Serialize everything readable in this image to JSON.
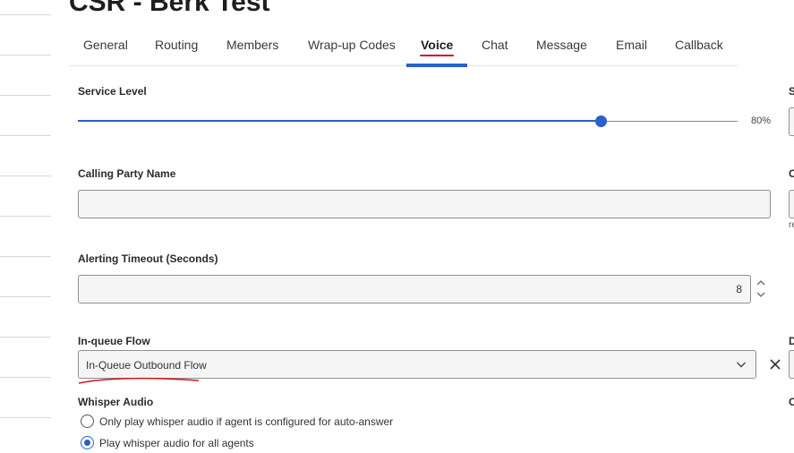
{
  "page": {
    "title": "CSR - Berk Test"
  },
  "tabs": [
    {
      "label": "General",
      "active": false
    },
    {
      "label": "Routing",
      "active": false
    },
    {
      "label": "Members",
      "active": false
    },
    {
      "label": "Wrap-up Codes",
      "active": false
    },
    {
      "label": "Voice",
      "active": true
    },
    {
      "label": "Chat",
      "active": false
    },
    {
      "label": "Message",
      "active": false
    },
    {
      "label": "Email",
      "active": false
    },
    {
      "label": "Callback",
      "active": false
    }
  ],
  "service_level": {
    "label": "Service Level",
    "value": 0.8,
    "display": "80%"
  },
  "calling_party_name": {
    "label": "Calling Party Name",
    "value": ""
  },
  "alerting_timeout": {
    "label": "Alerting Timeout (Seconds)",
    "value": "8"
  },
  "inqueue_flow": {
    "label": "In-queue Flow",
    "value": "In-Queue Outbound Flow"
  },
  "whisper_audio": {
    "label": "Whisper Audio",
    "options": [
      {
        "label": "Only play whisper audio if agent is configured for auto-answer",
        "checked": false
      },
      {
        "label": "Play whisper audio for all agents",
        "checked": true
      }
    ]
  },
  "right_column": {
    "label_1": "S",
    "label_2": "C",
    "small_text": "re",
    "label_3": "D",
    "label_4": "C"
  },
  "colors": {
    "accent": "#2a60c8",
    "annotation": "#d0141c"
  }
}
